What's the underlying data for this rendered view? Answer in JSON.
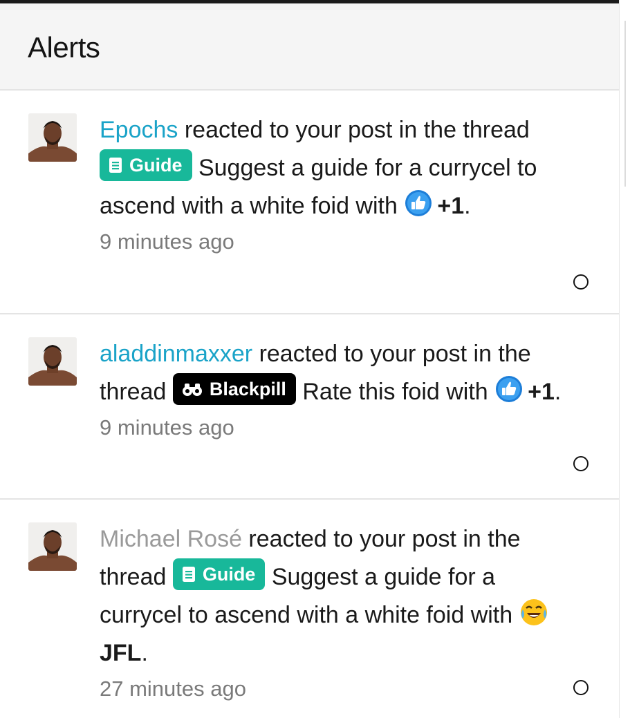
{
  "header": {
    "title": "Alerts"
  },
  "alerts": [
    {
      "username": "Epochs",
      "text_before": " reacted to your post in the thread ",
      "prefix_label": "Guide",
      "thread_title": " Suggest a guide for a currycel to ascend with a white foid with ",
      "reaction": "+1",
      "reaction_icon": "thumbs-up-icon",
      "end": ".",
      "time": "9 minutes ago"
    },
    {
      "username": "aladdinmaxxer",
      "text_before": " reacted to your post in the thread ",
      "prefix_label": "Blackpill",
      "thread_title": " Rate this foid with ",
      "reaction": "+1",
      "reaction_icon": "thumbs-up-icon",
      "end": ".",
      "time": "9 minutes ago"
    },
    {
      "username": "Michael Rosé",
      "text_before": " reacted to your post in the thread ",
      "prefix_label": "Guide",
      "thread_title": " Suggest a guide for a currycel to ascend with a white foid with ",
      "reaction": "JFL",
      "reaction_icon": "laughing-tears-icon",
      "end": ".",
      "time": "27 minutes ago"
    }
  ],
  "colors": {
    "link": "#1aa3c8",
    "guide": "#18b89a",
    "blackpill": "#000000",
    "muted_user": "#9a9a9a"
  }
}
